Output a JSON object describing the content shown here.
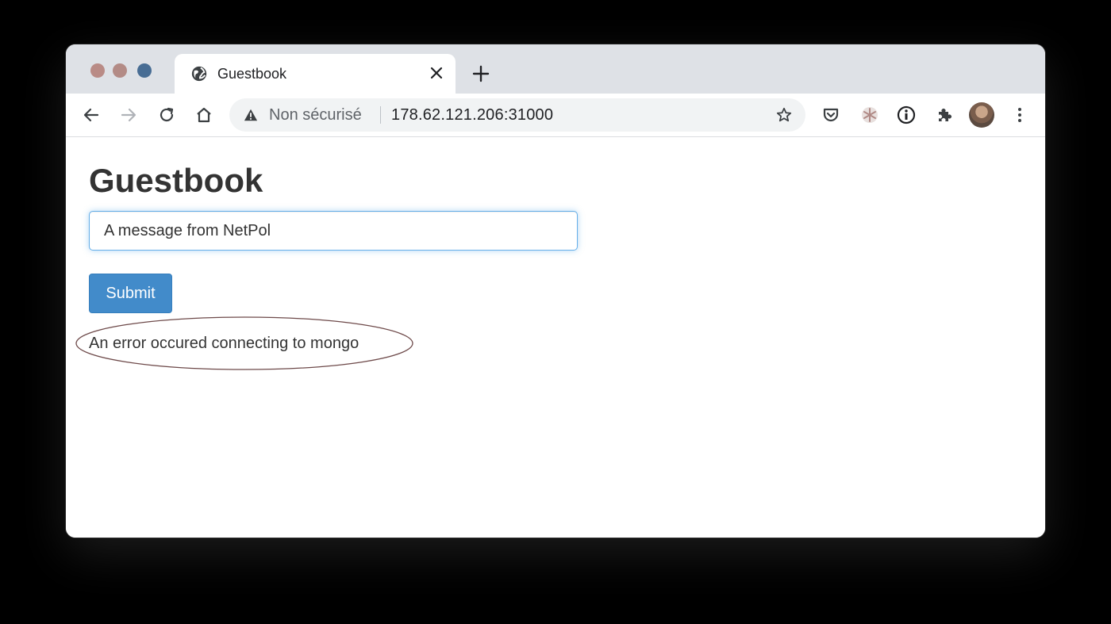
{
  "browser": {
    "tab": {
      "title": "Guestbook",
      "favicon": "globe-icon"
    },
    "address_bar": {
      "security_label": "Non sécurisé",
      "url": "178.62.121.206:31000"
    },
    "icons": {
      "back": "arrow-left-icon",
      "forward": "arrow-right-icon",
      "reload": "reload-icon",
      "home": "home-icon",
      "warning": "warning-icon",
      "bookmark": "star-icon",
      "pocket": "pocket-icon",
      "extension_a": "snowflake-icon",
      "extension_b": "info-circle-icon",
      "extensions": "puzzle-icon",
      "menu": "kebab-menu-icon"
    }
  },
  "page": {
    "title": "Guestbook",
    "input": {
      "value": "A message from NetPol"
    },
    "submit_label": "Submit",
    "error_message": "An error occured connecting to mongo"
  },
  "colors": {
    "submit_button": "#428bca",
    "input_focus_border": "#66afe9",
    "annotation_ellipse": "#6e4a4a",
    "tabstrip": "#dee1e6"
  }
}
